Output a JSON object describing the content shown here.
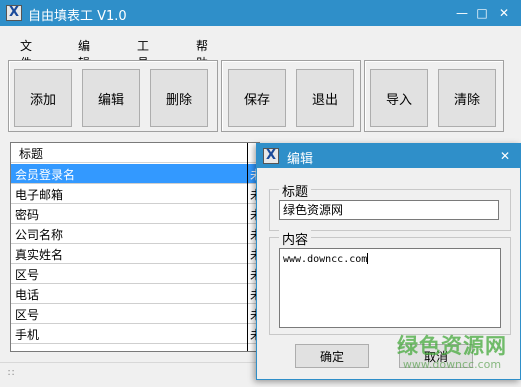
{
  "window": {
    "title": "自由填表工 V1.0",
    "logo_glyph": "X"
  },
  "menu": [
    {
      "label": "文件(F)"
    },
    {
      "label": "编辑(E)"
    },
    {
      "label": "工具(T)"
    },
    {
      "label": "帮助(H)"
    }
  ],
  "toolbar": {
    "add": "添加",
    "edit": "编辑",
    "delete": "删除",
    "save": "保存",
    "exit": "退出",
    "import": "导入",
    "clear": "清除"
  },
  "list": {
    "column_title": "标题",
    "rows": [
      {
        "title": "会员登录名",
        "status": "未"
      },
      {
        "title": "电子邮箱",
        "status": "未"
      },
      {
        "title": "密码",
        "status": "未"
      },
      {
        "title": "公司名称",
        "status": "未"
      },
      {
        "title": "真实姓名",
        "status": "未"
      },
      {
        "title": "区号",
        "status": "未"
      },
      {
        "title": "电话",
        "status": "未"
      },
      {
        "title": "区号",
        "status": "未"
      },
      {
        "title": "手机",
        "status": "未"
      }
    ]
  },
  "dialog": {
    "title": "编辑",
    "title_group": "标题",
    "title_value": "绿色资源网",
    "content_group": "内容",
    "content_value": "www.downcc.com",
    "ok_label": "确定",
    "cancel_label": "取消"
  },
  "watermark": {
    "main": "绿色资源网",
    "sub": "www.downcc.com"
  },
  "colors": {
    "titlebar": "#2f8fc9",
    "selection": "#3399ff",
    "watermark": "#46aa3c"
  }
}
